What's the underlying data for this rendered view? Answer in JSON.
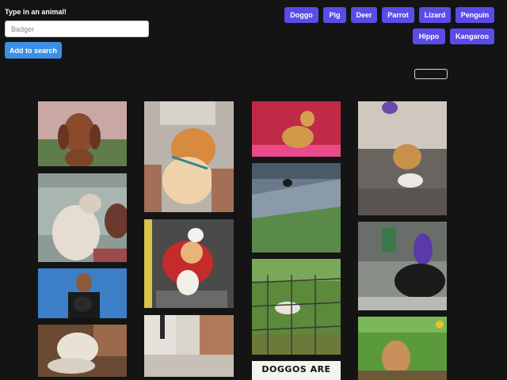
{
  "form": {
    "label": "Type in an animal!",
    "input_value": "",
    "input_placeholder": "Badger",
    "add_button_label": "Add to search"
  },
  "animal_buttons": [
    "Doggo",
    "Pig",
    "Deer",
    "Parrot",
    "Lizard",
    "Penguin",
    "Hippo",
    "Kangaroo"
  ],
  "gif_captions": {
    "doggos_are": "DOGGOS ARE"
  },
  "colors": {
    "background": "#141414",
    "tag_button": "#5a4ce8",
    "add_button": "#3d8fe6"
  }
}
